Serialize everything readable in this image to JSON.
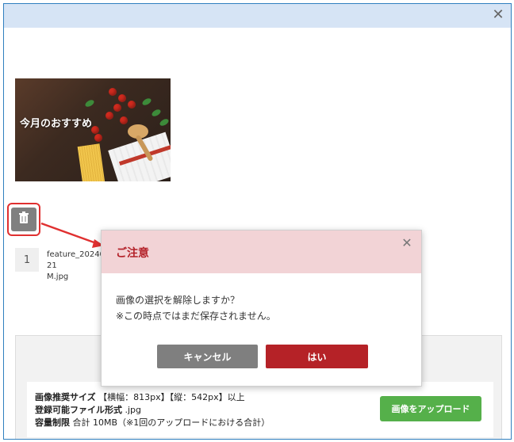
{
  "header": {
    "close_icon": "close-icon"
  },
  "image": {
    "overlay_title": "今月のおすすめ"
  },
  "file": {
    "index": "1",
    "name": "feature_2024021\nM.jpg"
  },
  "delete_button": {
    "icon": "trash-icon"
  },
  "upload": {
    "recommended_label": "画像推奨サイズ",
    "recommended_value": "【横幅：813px】【縦：542px】以上",
    "format_label": "登録可能ファイル形式",
    "format_value": ".jpg",
    "limit_label": "容量制限",
    "limit_value": "合計 10MB（※1回のアップロードにおける合計）",
    "button_label": "画像をアップロード"
  },
  "modal": {
    "title": "ご注意",
    "body_line1": "画像の選択を解除しますか？",
    "body_line2": "※この時点ではまだ保存されません。",
    "cancel_label": "キャンセル",
    "confirm_label": "はい"
  },
  "colors": {
    "frame_border": "#2f7fbf",
    "topbar": "#d6e4f5",
    "modal_header": "#f2d3d6",
    "modal_title": "#b32028",
    "confirm_button": "#b52227",
    "cancel_button": "#7f7f7f",
    "upload_button": "#55b04a",
    "highlight": "#e03030"
  }
}
